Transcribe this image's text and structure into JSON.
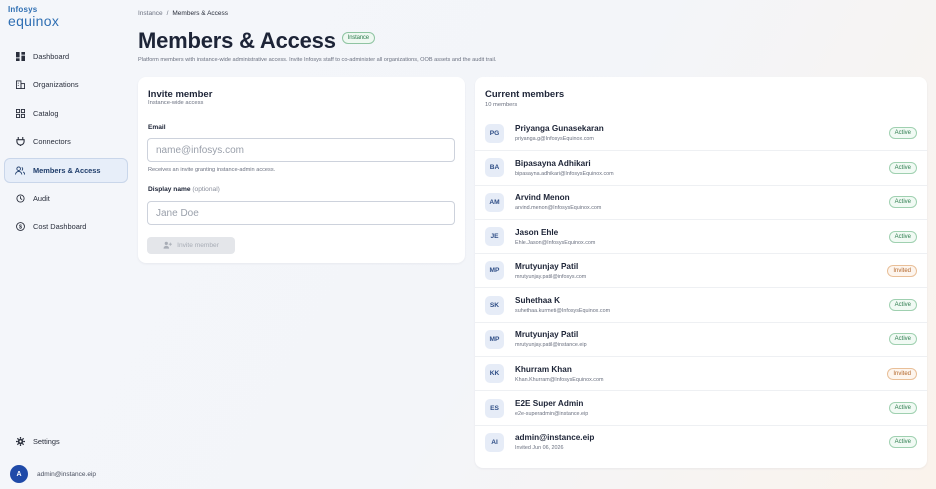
{
  "brand": {
    "top": "Infosys",
    "main": "equinox"
  },
  "sidebar": {
    "items": [
      {
        "label": "Dashboard",
        "icon": "dashboard-icon",
        "active": false
      },
      {
        "label": "Organizations",
        "icon": "building-icon",
        "active": false
      },
      {
        "label": "Catalog",
        "icon": "catalog-icon",
        "active": false
      },
      {
        "label": "Connectors",
        "icon": "plug-icon",
        "active": false
      },
      {
        "label": "Members & Access",
        "icon": "users-icon",
        "active": true
      },
      {
        "label": "Audit",
        "icon": "history-icon",
        "active": false
      },
      {
        "label": "Cost Dashboard",
        "icon": "dollar-icon",
        "active": false
      }
    ],
    "settings_label": "Settings",
    "user": {
      "initial": "A",
      "email": "admin@instance.eip"
    }
  },
  "breadcrumb": {
    "root": "Instance",
    "separator": "/",
    "current": "Members & Access"
  },
  "page": {
    "title": "Members & Access",
    "badge": "Instance",
    "subtitle": "Platform members with instance-wide administrative access. Invite Infosys staff to co-administer all organizations, OOB assets and the audit trail."
  },
  "invite": {
    "title": "Invite member",
    "subtitle": "Instance-wide access",
    "email_label": "Email",
    "email_placeholder": "name@infosys.com",
    "email_value": "",
    "help": "Receives an invite granting instance-admin access.",
    "name_label": "Display name",
    "name_optional": "(optional)",
    "name_placeholder": "Jane Doe",
    "name_value": "",
    "button_label": "Invite member"
  },
  "members": {
    "title": "Current members",
    "count": "10 members",
    "list": [
      {
        "initials": "PG",
        "name": "Priyanga Gunasekaran",
        "email": "priyanga.g@InfosysEquinox.com",
        "status": "Active"
      },
      {
        "initials": "BA",
        "name": "Bipasayna Adhikari",
        "email": "bipasayna.adhikari@InfosysEquinox.com",
        "status": "Active"
      },
      {
        "initials": "AM",
        "name": "Arvind Menon",
        "email": "arvind.menon@InfosysEquinox.com",
        "status": "Active"
      },
      {
        "initials": "JE",
        "name": "Jason Ehle",
        "email": "Ehle.Jason@InfosysEquinox.com",
        "status": "Active"
      },
      {
        "initials": "MP",
        "name": "Mrutyunjay Patil",
        "email": "mrutyunjay.patil@infosys.com",
        "status": "Invited"
      },
      {
        "initials": "SK",
        "name": "Suhethaa K",
        "email": "suhethaa.kurmeti@InfosysEquinox.com",
        "status": "Active"
      },
      {
        "initials": "MP",
        "name": "Mrutyunjay Patil",
        "email": "mrutyunjay.patil@instance.eip",
        "status": "Active"
      },
      {
        "initials": "KK",
        "name": "Khurram Khan",
        "email": "Khan.Khurram@InfosysEquinox.com",
        "status": "Invited"
      },
      {
        "initials": "ES",
        "name": "E2E Super Admin",
        "email": "e2e-superadmin@instance.eip",
        "status": "Active"
      },
      {
        "initials": "AI",
        "name": "admin@instance.eip",
        "email": "Invited Jun 06, 2026",
        "status": "Active"
      }
    ]
  },
  "colors": {
    "accent": "#2f6fb3",
    "active_status": "#2e7d4f",
    "invited_status": "#b3662a",
    "avatar_bg": "#1f4aa8"
  }
}
